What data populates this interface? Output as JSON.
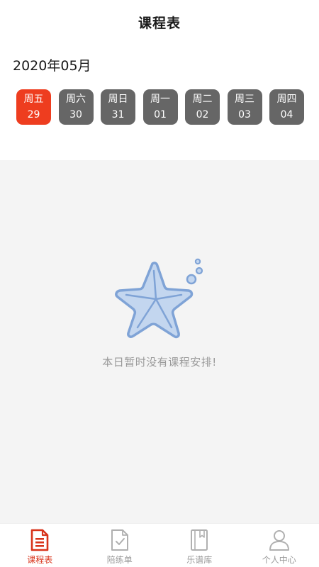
{
  "header": {
    "title": "课程表"
  },
  "calendar": {
    "month_label": "2020年05月",
    "days": [
      {
        "weekday": "周五",
        "date": "29",
        "selected": true
      },
      {
        "weekday": "周六",
        "date": "30",
        "selected": false
      },
      {
        "weekday": "周日",
        "date": "31",
        "selected": false
      },
      {
        "weekday": "周一",
        "date": "01",
        "selected": false
      },
      {
        "weekday": "周二",
        "date": "02",
        "selected": false
      },
      {
        "weekday": "周三",
        "date": "03",
        "selected": false
      },
      {
        "weekday": "周四",
        "date": "04",
        "selected": false
      }
    ]
  },
  "empty_state": {
    "message": "本日暂时没有课程安排!",
    "icon": "starfish-icon"
  },
  "tabbar": {
    "items": [
      {
        "label": "课程表",
        "icon": "schedule-icon",
        "active": true
      },
      {
        "label": "陪练单",
        "icon": "practice-list-icon",
        "active": false
      },
      {
        "label": "乐谱库",
        "icon": "score-library-icon",
        "active": false
      },
      {
        "label": "个人中心",
        "icon": "profile-icon",
        "active": false
      }
    ]
  },
  "colors": {
    "accent": "#ee3d1f",
    "day_chip": "#666666",
    "content_bg": "#f4f4f4",
    "icon_blue": "#7fa3d6"
  }
}
